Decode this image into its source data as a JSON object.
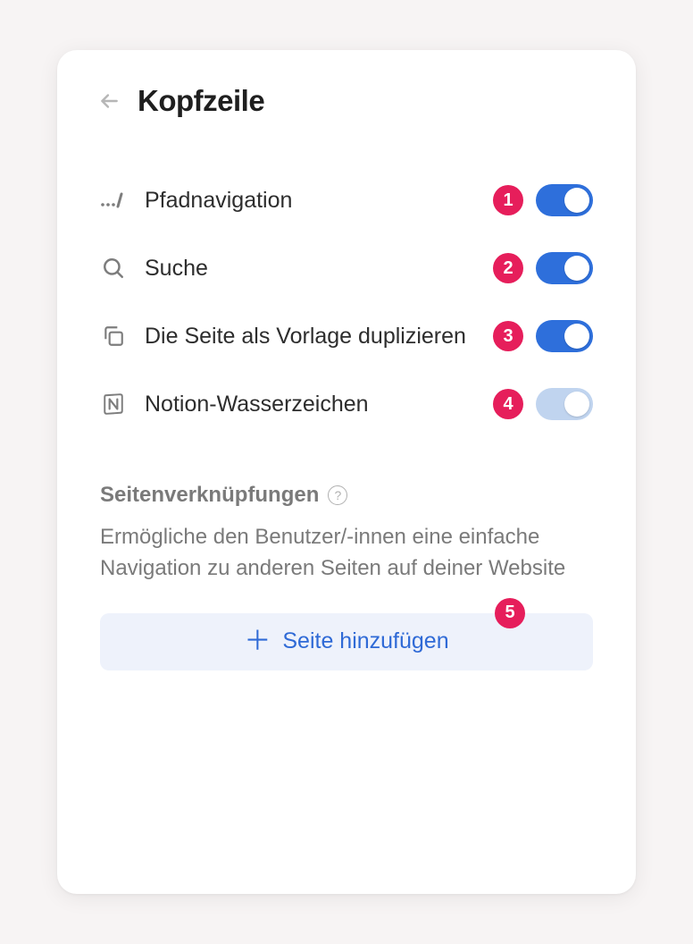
{
  "header": {
    "title": "Kopfzeile"
  },
  "options": [
    {
      "icon": "breadcrumb-icon",
      "label": "Pfadnavigation",
      "badge": "1",
      "toggle": "on"
    },
    {
      "icon": "search-icon",
      "label": "Suche",
      "badge": "2",
      "toggle": "on"
    },
    {
      "icon": "duplicate-icon",
      "label": "Die Seite als Vorlage duplizieren",
      "badge": "3",
      "toggle": "on"
    },
    {
      "icon": "notion-icon",
      "label": "Notion-Wasserzeichen",
      "badge": "4",
      "toggle": "on-light"
    }
  ],
  "section": {
    "heading": "Seitenverknüpfungen",
    "description": "Ermögliche den Benutzer/-innen eine einfache Navigation zu anderen Seiten auf deiner Website",
    "add_label": "Seite hinzufügen",
    "add_badge": "5"
  }
}
